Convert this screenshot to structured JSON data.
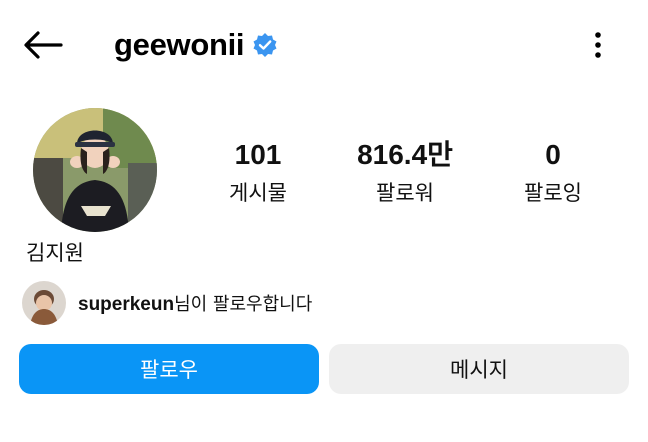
{
  "header": {
    "username": "geewonii",
    "back_icon": "arrow-left-icon",
    "verified_icon": "verified-badge-icon",
    "more_icon": "more-vertical-icon"
  },
  "profile": {
    "full_name": "김지원",
    "stats": [
      {
        "value": "101",
        "label": "게시물"
      },
      {
        "value": "816.4만",
        "label": "팔로워"
      },
      {
        "value": "0",
        "label": "팔로잉"
      }
    ]
  },
  "followed_by": {
    "username": "superkeun",
    "suffix": "님이 팔로우합니다"
  },
  "actions": {
    "follow_label": "팔로우",
    "message_label": "메시지"
  },
  "colors": {
    "accent": "#0a95f6",
    "verified": "#3b95f0",
    "secondary_button": "#efefef"
  }
}
